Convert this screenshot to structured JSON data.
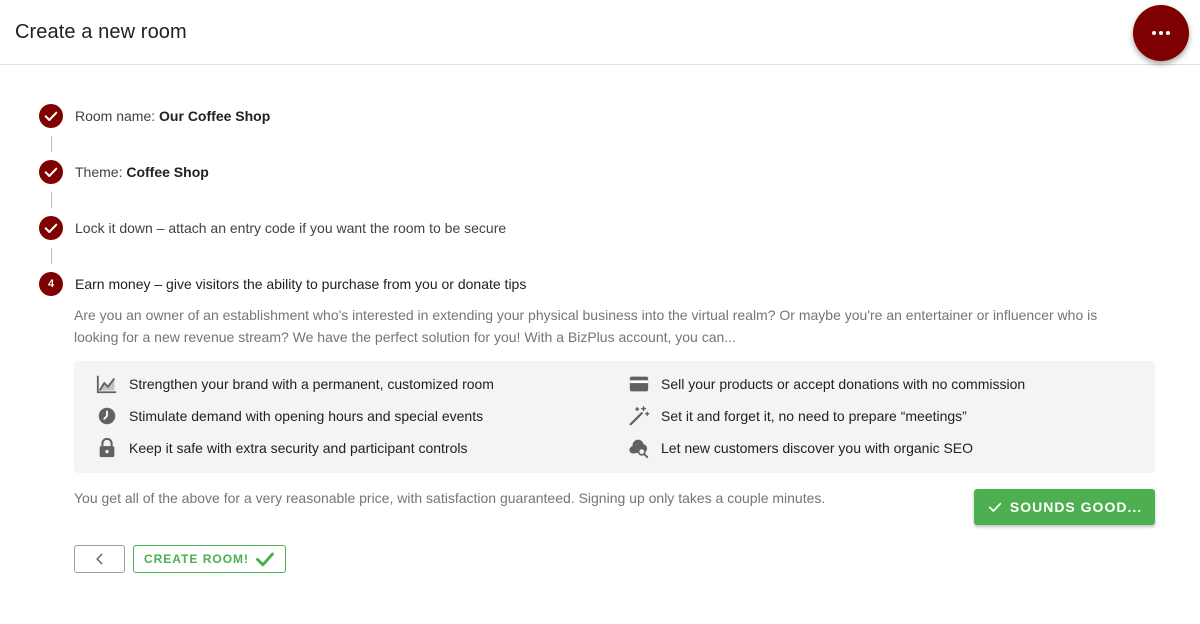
{
  "header": {
    "title": "Create a new room"
  },
  "fab": {
    "icon": "more-horizontal-icon"
  },
  "steps": [
    {
      "status": "complete",
      "label_prefix": "Room name: ",
      "label_value": "Our Coffee Shop"
    },
    {
      "status": "complete",
      "label_prefix": "Theme: ",
      "label_value": "Coffee Shop"
    },
    {
      "status": "complete",
      "label_prefix": "Lock it down – attach an entry code if you want the room to be secure",
      "label_value": ""
    },
    {
      "status": "active",
      "number": "4",
      "label_prefix": "Earn money – give visitors the ability to purchase from you or donate tips",
      "label_value": ""
    }
  ],
  "description": "Are you an owner of an establishment who's interested in extending your physical business into the virtual realm? Or maybe you're an entertainer or influencer who is looking for a new revenue stream? We have the perfect solution for you! With a BizPlus account, you can...",
  "features": [
    {
      "icon": "trending-chart-icon",
      "text": "Strengthen your brand with a permanent, customized room"
    },
    {
      "icon": "clock-icon",
      "text": "Stimulate demand with opening hours and special events"
    },
    {
      "icon": "lock-icon",
      "text": "Keep it safe with extra security and participant controls"
    },
    {
      "icon": "credit-card-icon",
      "text": "Sell your products or accept donations with no commission"
    },
    {
      "icon": "magic-wand-icon",
      "text": "Set it and forget it, no need to prepare “meetings”"
    },
    {
      "icon": "cloud-search-icon",
      "text": "Let new customers discover you with organic SEO"
    }
  ],
  "footer_text": "You get all of the above for a very reasonable price, with satisfaction guaranteed. Signing up only takes a couple minutes.",
  "sounds_good_label": "SOUNDS GOOD...",
  "create_room_label": "CREATE ROOM!",
  "colors": {
    "primary": "#7f0000",
    "success": "#4caf50",
    "panel": "#f4f4f4"
  }
}
